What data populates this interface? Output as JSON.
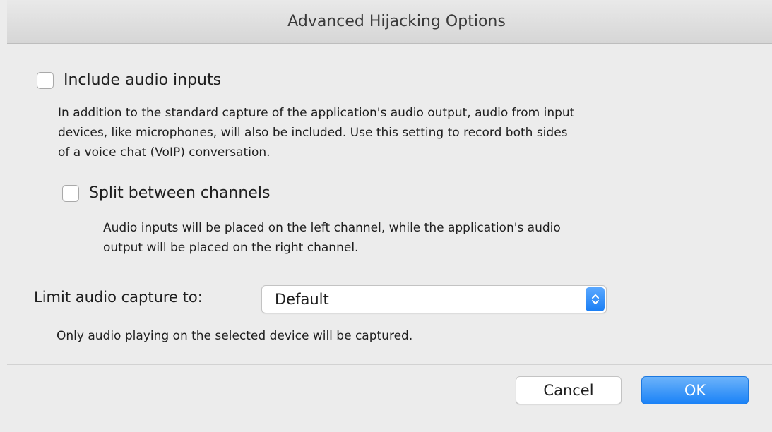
{
  "window": {
    "title": "Advanced Hijacking Options"
  },
  "include_audio_inputs": {
    "label": "Include audio inputs",
    "checked": false,
    "description_lines": [
      "In addition to the standard capture of the application's audio output, audio from input",
      "devices, like microphones, will also be included. Use this setting to record both sides",
      "of a voice chat (VoIP) conversation."
    ]
  },
  "split_channels": {
    "label": "Split between channels",
    "checked": false,
    "description_lines": [
      "Audio inputs will be placed on the left channel, while the application's audio",
      "output will be placed on the right channel."
    ]
  },
  "limit_capture": {
    "label": "Limit audio capture to:",
    "selected": "Default",
    "note": "Only audio playing on the selected device will be captured."
  },
  "buttons": {
    "cancel": "Cancel",
    "ok": "OK"
  },
  "colors": {
    "accent": "#1a82f7",
    "background": "#ececec"
  }
}
